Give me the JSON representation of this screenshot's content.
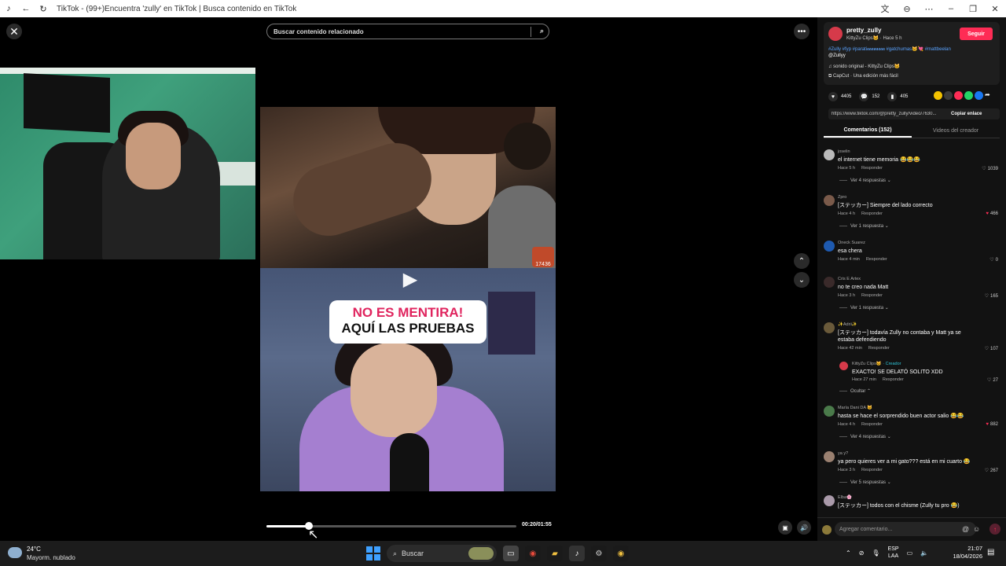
{
  "window": {
    "title": "TikTok - (99+)Encuentra 'zully' en TikTok | Busca contenido en TikTok"
  },
  "video": {
    "search_placeholder": "Buscar contenido relacionado",
    "caption_line1": "NO ES MENTIRA!",
    "caption_line2": "AQUÍ LAS PRUEBAS",
    "time": "00:20/01:55",
    "progress": 0.17,
    "sticker_text": "17436"
  },
  "author": {
    "username": "pretty_zully",
    "subline": "KittyZu Clips🐱 · Hace 5 h",
    "follow_label": "Seguir",
    "hashtags": "#Zully #fyp #parati𝖆𝖆𝖆𝖆𝖆𝖆𝖆𝖆 #gatchumas🐱💘 #mattbeelan",
    "mention": "@Zullyy",
    "sound": "sonido original - KittyZu Clips🐱",
    "capcut": "CapCut · Una edición más fácil"
  },
  "stats": {
    "likes": "4405",
    "comments": "152",
    "saves": "405"
  },
  "share": {
    "url": "https://www.tiktok.com/@pretty_zully/video/7630...",
    "copy_label": "Copiar enlace",
    "colors": [
      "#f3c200",
      "#3b3b3b",
      "#fe2c55",
      "#25d366",
      "#1877f2"
    ]
  },
  "tabs": [
    {
      "label": "Comentarios (152)",
      "active": true
    },
    {
      "label": "Videos del creador",
      "active": false
    }
  ],
  "comments": [
    {
      "user": "joselin",
      "text": "el internet tiene memoria 😂😂😂",
      "meta": "Hace 5 h",
      "reply": "Responder",
      "likes": "1039",
      "liked": false,
      "replies": "Ver 4 respuestas ⌄"
    },
    {
      "user": "Zpro",
      "text": "[ステッカー] Siempre del lado correcto",
      "meta": "Hace 4 h",
      "reply": "Responder",
      "likes": "466",
      "liked": true,
      "replies": "Ver 1 respuesta ⌄"
    },
    {
      "user": "Oneck Suarez",
      "text": "esa chera",
      "meta": "Hace 4 min",
      "reply": "Responder",
      "likes": "0",
      "liked": false,
      "replies": ""
    },
    {
      "user": "Cris E Artex",
      "text": "no te creo nada Matt",
      "meta": "Hace 3 h",
      "reply": "Responder",
      "likes": "165",
      "liked": false,
      "replies": "Ver 1 respuesta ⌄"
    },
    {
      "user": "✨Adrii✨",
      "text": "[ステッカー] todavía Zully no contaba y Matt ya se estaba defendiendo",
      "meta": "Hace 42 min",
      "reply": "Responder",
      "likes": "107",
      "liked": false,
      "replies": ""
    },
    {
      "user": "María Dani DA 🐱",
      "text": "hasta se hace el sorprendido buen actor salio 😂😂",
      "meta": "Hace 4 h",
      "reply": "Responder",
      "likes": "882",
      "liked": true,
      "replies": "Ver 4 respuestas ⌄"
    },
    {
      "user": "ya y?",
      "text": "ya pero quieres ver a mi gato??? está en mi cuarto 😂",
      "meta": "Hace 3 h",
      "reply": "Responder",
      "likes": "267",
      "liked": false,
      "replies": "Ver 5 respuestas ⌄"
    },
    {
      "user": "Elba🌸",
      "text": "[ステッカー] todos con el chisme (Zully tu pro 😂)",
      "meta": "",
      "reply": "",
      "likes": "",
      "liked": false,
      "replies": ""
    }
  ],
  "nested_reply": {
    "user": "KittyZu Clips🐱",
    "creator_tag": "· Creador",
    "text": "EXACTO! SE DELATÓ SOLITO XDD",
    "meta": "Hace 27 min",
    "reply": "Responder",
    "likes": "27",
    "hide_label": "Ocultar ⌃"
  },
  "add_comment": {
    "placeholder": "Agregar comentario..."
  },
  "taskbar": {
    "temp": "24°C",
    "condition": "Mayorm. nublado",
    "search_label": "Buscar",
    "lang_top": "ESP",
    "lang_bottom": "LAA",
    "time": "21:07",
    "date": "18/04/2026"
  }
}
